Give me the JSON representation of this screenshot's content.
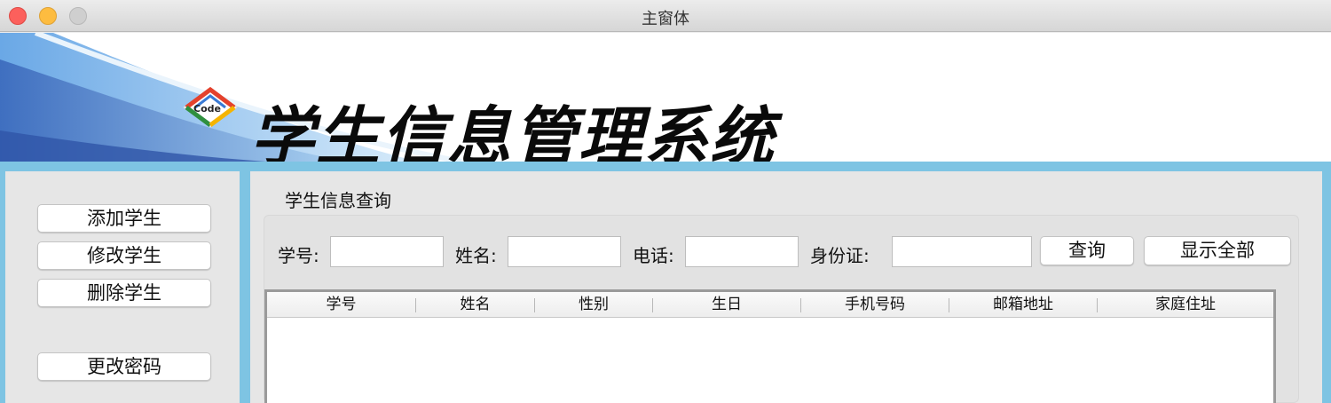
{
  "window": {
    "title": "主窗体"
  },
  "banner": {
    "title": "学生信息管理系统",
    "logo_text": "Code"
  },
  "sidebar": {
    "buttons": [
      {
        "label": "添加学生"
      },
      {
        "label": "修改学生"
      },
      {
        "label": "删除学生"
      },
      {
        "label": "更改密码"
      }
    ]
  },
  "query": {
    "section_title": "学生信息查询",
    "fields": [
      {
        "label": "学号:",
        "value": ""
      },
      {
        "label": "姓名:",
        "value": ""
      },
      {
        "label": "电话:",
        "value": ""
      },
      {
        "label": "身份证:",
        "value": ""
      }
    ],
    "search_button": "查询",
    "show_all_button": "显示全部"
  },
  "table": {
    "columns": [
      "学号",
      "姓名",
      "性别",
      "生日",
      "手机号码",
      "邮箱地址",
      "家庭住址"
    ],
    "rows": []
  },
  "colors": {
    "frame_blue": "#7ec4e3"
  }
}
